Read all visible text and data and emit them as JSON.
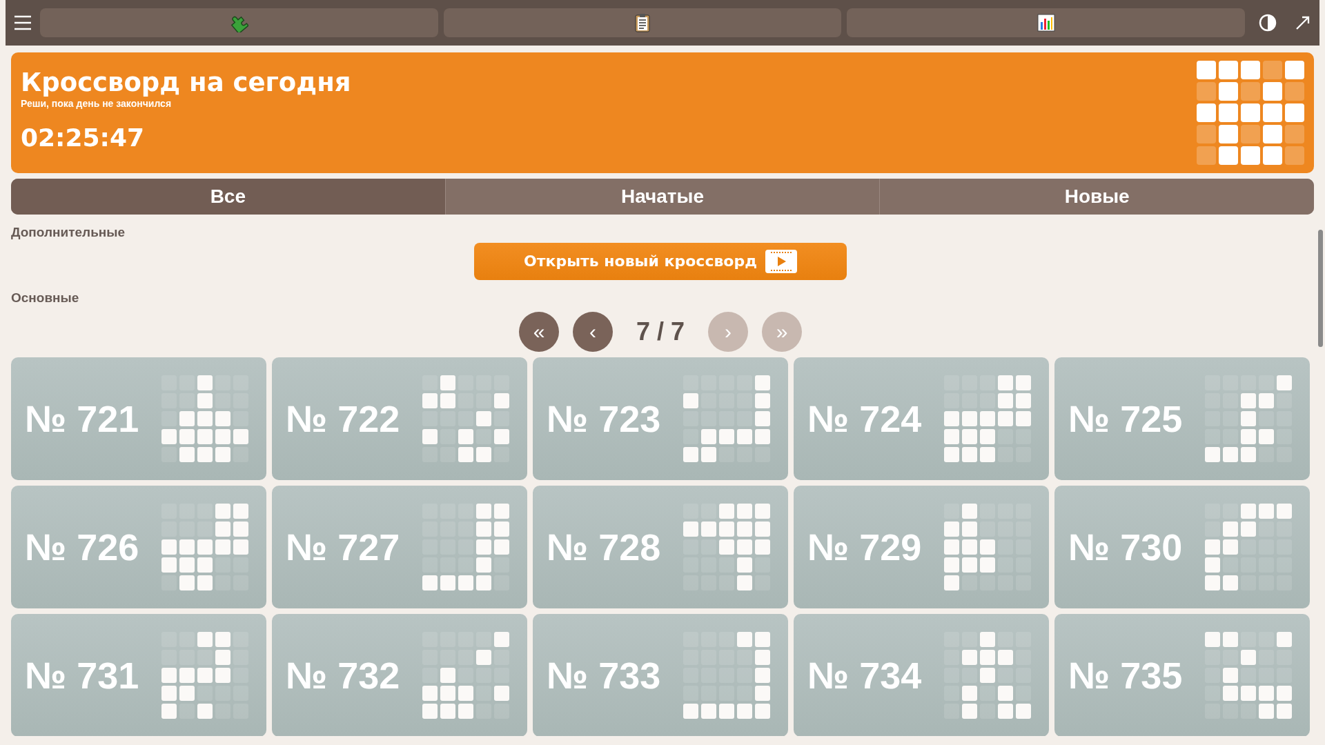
{
  "banner": {
    "title": "Кроссворд на сегодня",
    "subtitle": "Реши, пока день не закончился",
    "timer": "02:25:47",
    "grid": [
      [
        true,
        true,
        true,
        false,
        true
      ],
      [
        false,
        true,
        false,
        true,
        false
      ],
      [
        true,
        true,
        true,
        true,
        true
      ],
      [
        false,
        true,
        false,
        true,
        false
      ],
      [
        false,
        true,
        true,
        true,
        false
      ]
    ]
  },
  "filter_tabs": [
    {
      "label": "Все",
      "selected": true
    },
    {
      "label": "Начатые",
      "selected": false
    },
    {
      "label": "Новые",
      "selected": false
    }
  ],
  "extra_section": {
    "heading": "Дополнительные",
    "button": "Открыть новый кроссворд"
  },
  "main_section": {
    "heading": "Основные"
  },
  "pagination": {
    "buttons": [
      {
        "label": "«",
        "disabled": false
      },
      {
        "label": "‹",
        "disabled": false
      },
      {
        "label": "›",
        "disabled": true
      },
      {
        "label": "»",
        "disabled": true
      }
    ],
    "page": "7 / 7"
  },
  "puzzles": [
    {
      "label": "№ 721",
      "grid": [
        [
          false,
          false,
          true,
          false,
          false
        ],
        [
          false,
          false,
          true,
          false,
          false
        ],
        [
          false,
          true,
          true,
          true,
          false
        ],
        [
          true,
          true,
          true,
          true,
          true
        ],
        [
          false,
          true,
          true,
          true,
          false
        ]
      ]
    },
    {
      "label": "№ 722",
      "grid": [
        [
          false,
          true,
          false,
          false,
          false
        ],
        [
          true,
          true,
          false,
          false,
          true
        ],
        [
          false,
          false,
          false,
          true,
          false
        ],
        [
          true,
          false,
          true,
          false,
          true
        ],
        [
          false,
          false,
          true,
          true,
          false
        ]
      ]
    },
    {
      "label": "№ 723",
      "grid": [
        [
          false,
          false,
          false,
          false,
          true
        ],
        [
          true,
          false,
          false,
          false,
          true
        ],
        [
          false,
          false,
          false,
          false,
          true
        ],
        [
          false,
          true,
          true,
          true,
          true
        ],
        [
          true,
          true,
          false,
          false,
          false
        ]
      ]
    },
    {
      "label": "№ 724",
      "grid": [
        [
          false,
          false,
          false,
          true,
          true
        ],
        [
          false,
          false,
          false,
          true,
          true
        ],
        [
          true,
          true,
          true,
          true,
          true
        ],
        [
          true,
          true,
          true,
          false,
          false
        ],
        [
          true,
          true,
          true,
          false,
          false
        ]
      ]
    },
    {
      "label": "№ 725",
      "grid": [
        [
          false,
          false,
          false,
          false,
          true
        ],
        [
          false,
          false,
          true,
          true,
          false
        ],
        [
          false,
          false,
          true,
          false,
          false
        ],
        [
          false,
          false,
          true,
          true,
          false
        ],
        [
          true,
          true,
          true,
          false,
          false
        ]
      ]
    },
    {
      "label": "№ 726",
      "grid": [
        [
          false,
          false,
          false,
          true,
          true
        ],
        [
          false,
          false,
          false,
          true,
          true
        ],
        [
          true,
          true,
          true,
          true,
          true
        ],
        [
          true,
          true,
          true,
          false,
          false
        ],
        [
          false,
          true,
          true,
          false,
          false
        ]
      ]
    },
    {
      "label": "№ 727",
      "grid": [
        [
          false,
          false,
          false,
          true,
          true
        ],
        [
          false,
          false,
          false,
          true,
          true
        ],
        [
          false,
          false,
          false,
          true,
          true
        ],
        [
          false,
          false,
          false,
          true,
          false
        ],
        [
          true,
          true,
          true,
          true,
          false
        ]
      ]
    },
    {
      "label": "№ 728",
      "grid": [
        [
          false,
          false,
          true,
          true,
          true
        ],
        [
          true,
          true,
          true,
          true,
          true
        ],
        [
          false,
          false,
          true,
          true,
          true
        ],
        [
          false,
          false,
          false,
          true,
          false
        ],
        [
          false,
          false,
          false,
          true,
          false
        ]
      ]
    },
    {
      "label": "№ 729",
      "grid": [
        [
          false,
          true,
          false,
          false,
          false
        ],
        [
          true,
          true,
          false,
          false,
          false
        ],
        [
          true,
          true,
          true,
          false,
          false
        ],
        [
          true,
          true,
          true,
          false,
          false
        ],
        [
          true,
          false,
          false,
          false,
          false
        ]
      ]
    },
    {
      "label": "№ 730",
      "grid": [
        [
          false,
          false,
          true,
          true,
          true
        ],
        [
          false,
          true,
          true,
          false,
          false
        ],
        [
          true,
          true,
          false,
          false,
          false
        ],
        [
          true,
          false,
          false,
          false,
          false
        ],
        [
          true,
          true,
          false,
          false,
          false
        ]
      ]
    },
    {
      "label": "№ 731",
      "grid": [
        [
          false,
          false,
          true,
          true,
          false
        ],
        [
          false,
          false,
          false,
          true,
          false
        ],
        [
          true,
          true,
          true,
          true,
          false
        ],
        [
          true,
          true,
          false,
          false,
          false
        ],
        [
          true,
          false,
          true,
          false,
          false
        ]
      ]
    },
    {
      "label": "№ 732",
      "grid": [
        [
          false,
          false,
          false,
          false,
          true
        ],
        [
          false,
          false,
          false,
          true,
          false
        ],
        [
          false,
          true,
          false,
          false,
          false
        ],
        [
          true,
          true,
          true,
          false,
          true
        ],
        [
          true,
          true,
          true,
          false,
          false
        ]
      ]
    },
    {
      "label": "№ 733",
      "grid": [
        [
          false,
          false,
          false,
          true,
          true
        ],
        [
          false,
          false,
          false,
          false,
          true
        ],
        [
          false,
          false,
          false,
          false,
          true
        ],
        [
          false,
          false,
          false,
          false,
          true
        ],
        [
          true,
          true,
          true,
          true,
          true
        ]
      ]
    },
    {
      "label": "№ 734",
      "grid": [
        [
          false,
          false,
          true,
          false,
          false
        ],
        [
          false,
          true,
          true,
          true,
          false
        ],
        [
          false,
          false,
          true,
          false,
          false
        ],
        [
          false,
          true,
          false,
          true,
          false
        ],
        [
          false,
          true,
          false,
          true,
          true
        ]
      ]
    },
    {
      "label": "№ 735",
      "grid": [
        [
          true,
          true,
          false,
          false,
          true
        ],
        [
          false,
          false,
          true,
          false,
          false
        ],
        [
          false,
          true,
          false,
          false,
          false
        ],
        [
          false,
          true,
          true,
          true,
          true
        ],
        [
          false,
          false,
          false,
          true,
          true
        ]
      ]
    }
  ]
}
